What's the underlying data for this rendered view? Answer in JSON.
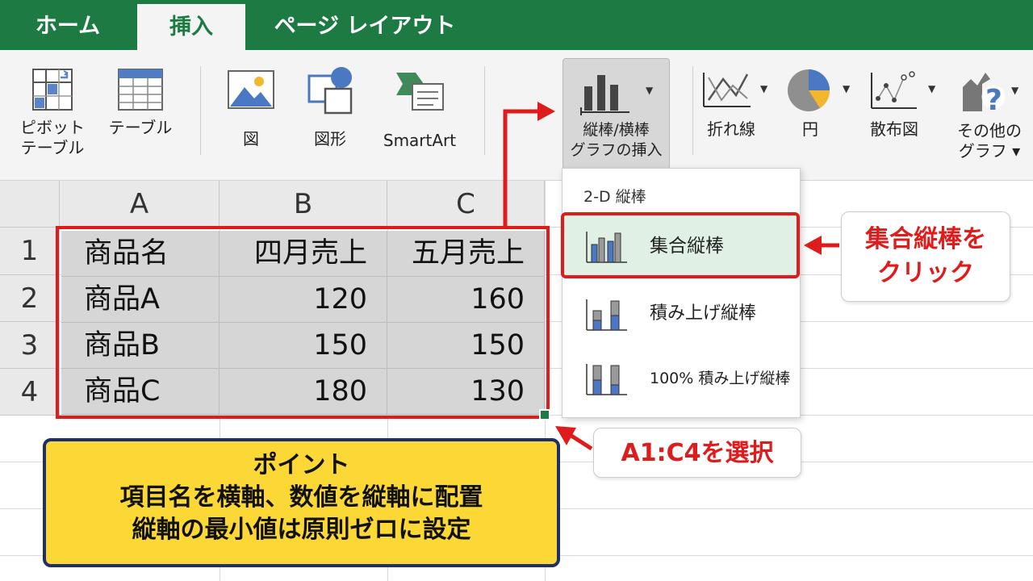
{
  "tabs": {
    "home": "ホーム",
    "insert": "挿入",
    "page_layout": "ページ レイアウト"
  },
  "ribbon": {
    "pivot_table": "ピボット\nテーブル",
    "table": "テーブル",
    "picture": "図",
    "shapes": "図形",
    "smartart": "SmartArt",
    "column_chart": "縦棒/横棒\nグラフの挿入",
    "line": "折れ線",
    "pie": "円",
    "scatter": "散布図",
    "other_charts": "その他の\nグラフ ▾"
  },
  "sheet": {
    "columns": [
      "A",
      "B",
      "C"
    ],
    "rows": [
      "1",
      "2",
      "3",
      "4"
    ],
    "header": [
      "商品名",
      "四月売上",
      "五月売上"
    ],
    "data": [
      [
        "商品A",
        "120",
        "160"
      ],
      [
        "商品B",
        "150",
        "150"
      ],
      [
        "商品C",
        "180",
        "130"
      ]
    ]
  },
  "menu": {
    "heading": "2-D 縦棒",
    "items": [
      "集合縦棒",
      "積み上げ縦棒",
      "100% 積み上げ縦棒"
    ]
  },
  "callouts": {
    "clustered": [
      "集合縦棒を",
      "クリック"
    ],
    "select_range": "A1:C4を選択"
  },
  "note": {
    "title": "ポイント",
    "lines": [
      "項目名を横軸、数値を縦軸に配置",
      "縦軸の最小値は原則ゼロに設定"
    ]
  },
  "colors": {
    "excel_green": "#1e7a43",
    "highlight_red": "#e01b1b",
    "note_yellow": "#fbd835",
    "note_border": "#1f2f6b"
  },
  "icons": {
    "pivot_table": "pivot-table-icon",
    "table": "table-icon",
    "picture": "picture-icon",
    "shapes": "shapes-icon",
    "smartart": "smartart-icon",
    "column_chart": "column-chart-icon",
    "line": "line-chart-icon",
    "pie": "pie-chart-icon",
    "scatter": "scatter-chart-icon",
    "other_charts": "other-charts-icon"
  }
}
